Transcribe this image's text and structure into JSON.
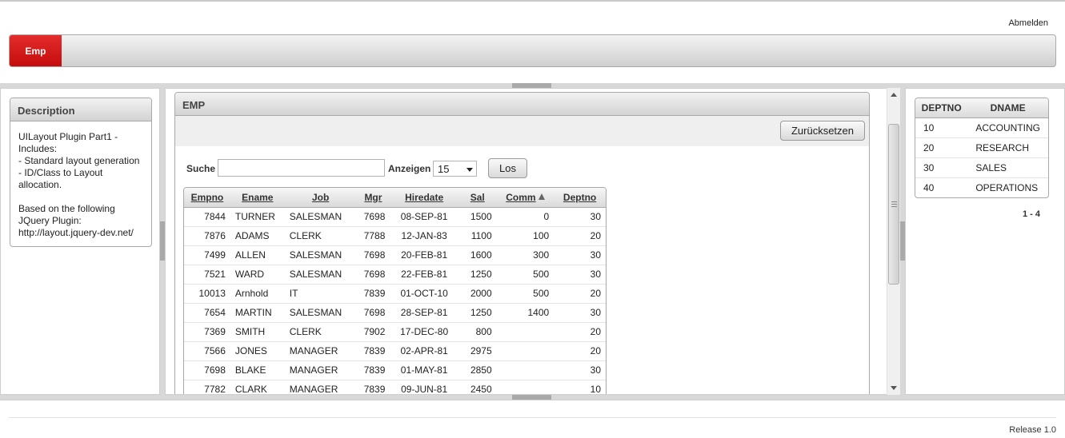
{
  "header": {
    "logout_label": "Abmelden",
    "tabs": [
      {
        "label": "Emp",
        "active": true
      }
    ],
    "accent_color": "#d51a1a"
  },
  "description": {
    "title": "Description",
    "text": "UILayout Plugin Part1 -\nIncludes:\n- Standard layout generation\n- ID/Class to Layout\nallocation.\n\nBased on the following\nJQuery Plugin:\nhttp://layout.jquery-dev.net/"
  },
  "emp_region": {
    "title": "EMP",
    "reset_label": "Zurücksetzen",
    "search_label": "Suche",
    "search_value": "",
    "display_label": "Anzeigen",
    "display_value": "15",
    "go_label": "Los",
    "columns": [
      "Empno",
      "Ename",
      "Job",
      "Mgr",
      "Hiredate",
      "Sal",
      "Comm",
      "Deptno"
    ],
    "sorted_column": "Comm",
    "rows": [
      [
        "7844",
        "TURNER",
        "SALESMAN",
        "7698",
        "08-SEP-81",
        "1500",
        "0",
        "30"
      ],
      [
        "7876",
        "ADAMS",
        "CLERK",
        "7788",
        "12-JAN-83",
        "1100",
        "100",
        "20"
      ],
      [
        "7499",
        "ALLEN",
        "SALESMAN",
        "7698",
        "20-FEB-81",
        "1600",
        "300",
        "30"
      ],
      [
        "7521",
        "WARD",
        "SALESMAN",
        "7698",
        "22-FEB-81",
        "1250",
        "500",
        "30"
      ],
      [
        "10013",
        "Arnhold",
        "IT",
        "7839",
        "01-OCT-10",
        "2000",
        "500",
        "20"
      ],
      [
        "7654",
        "MARTIN",
        "SALESMAN",
        "7698",
        "28-SEP-81",
        "1250",
        "1400",
        "30"
      ],
      [
        "7369",
        "SMITH",
        "CLERK",
        "7902",
        "17-DEC-80",
        "800",
        "",
        "20"
      ],
      [
        "7566",
        "JONES",
        "MANAGER",
        "7839",
        "02-APR-81",
        "2975",
        "",
        "20"
      ],
      [
        "7698",
        "BLAKE",
        "MANAGER",
        "7839",
        "01-MAY-81",
        "2850",
        "",
        "30"
      ],
      [
        "7782",
        "CLARK",
        "MANAGER",
        "7839",
        "09-JUN-81",
        "2450",
        "",
        "10"
      ]
    ]
  },
  "dept_region": {
    "columns": [
      "DEPTNO",
      "DNAME"
    ],
    "rows": [
      [
        "10",
        "ACCOUNTING"
      ],
      [
        "20",
        "RESEARCH"
      ],
      [
        "30",
        "SALES"
      ],
      [
        "40",
        "OPERATIONS"
      ]
    ],
    "pagination": "1 - 4"
  },
  "footer": {
    "release": "Release 1.0"
  }
}
